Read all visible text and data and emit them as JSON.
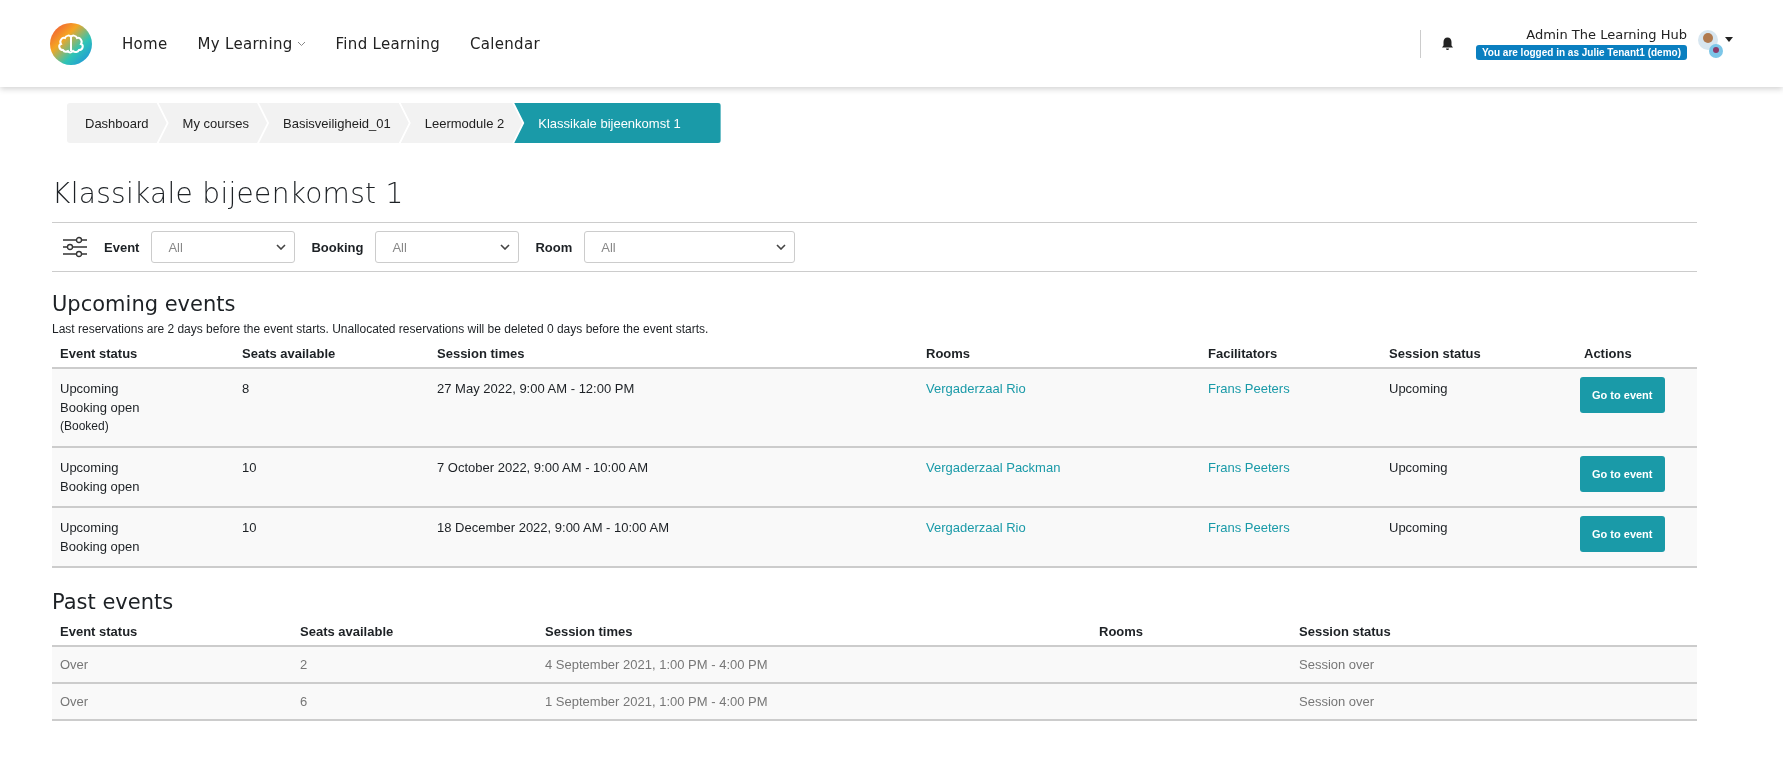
{
  "nav": {
    "items": [
      {
        "label": "Home",
        "has_dropdown": false
      },
      {
        "label": "My Learning",
        "has_dropdown": true
      },
      {
        "label": "Find Learning",
        "has_dropdown": false
      },
      {
        "label": "Calendar",
        "has_dropdown": false
      }
    ]
  },
  "user": {
    "name": "Admin The Learning Hub",
    "login_badge": "You are logged in as Julie Tenant1 (demo)"
  },
  "breadcrumb": [
    {
      "label": "Dashboard",
      "selected": false
    },
    {
      "label": "My courses",
      "selected": false
    },
    {
      "label": "Basisveiligheid_01",
      "selected": false
    },
    {
      "label": "Leermodule 2",
      "selected": false
    },
    {
      "label": "Klassikale bijeenkomst 1",
      "selected": true
    }
  ],
  "page_title": "Klassikale bijeenkomst 1",
  "filters": [
    {
      "label": "Event",
      "value": "All",
      "wide": false
    },
    {
      "label": "Booking",
      "value": "All",
      "wide": false
    },
    {
      "label": "Room",
      "value": "All",
      "wide": true
    }
  ],
  "upcoming": {
    "title": "Upcoming events",
    "note": "Last reservations are 2 days before the event starts. Unallocated reservations will be deleted 0 days before the event starts.",
    "columns": [
      "Event status",
      "Seats available",
      "Session times",
      "Rooms",
      "Facilitators",
      "Session status",
      "Actions"
    ],
    "rows": [
      {
        "event_status": [
          "Upcoming",
          "Booking open"
        ],
        "booked_note": "(Booked)",
        "seats": "8",
        "session_times": "27 May 2022, 9:00 AM - 12:00 PM",
        "room": "Vergaderzaal Rio",
        "facilitator": "Frans Peeters",
        "session_status": "Upcoming",
        "action": "Go to event"
      },
      {
        "event_status": [
          "Upcoming",
          "Booking open"
        ],
        "seats": "10",
        "session_times": "7 October 2022, 9:00 AM - 10:00 AM",
        "room": "Vergaderzaal Packman",
        "facilitator": "Frans Peeters",
        "session_status": "Upcoming",
        "action": "Go to event"
      },
      {
        "event_status": [
          "Upcoming",
          "Booking open"
        ],
        "seats": "10",
        "session_times": "18 December 2022, 9:00 AM - 10:00 AM",
        "room": "Vergaderzaal Rio",
        "facilitator": "Frans Peeters",
        "session_status": "Upcoming",
        "action": "Go to event"
      }
    ]
  },
  "past": {
    "title": "Past events",
    "columns": [
      "Event status",
      "Seats available",
      "Session times",
      "Rooms",
      "Session status"
    ],
    "rows": [
      {
        "event_status": "Over",
        "seats": "2",
        "session_times": "4 September 2021, 1:00 PM - 4:00 PM",
        "session_status": "Session over"
      },
      {
        "event_status": "Over",
        "seats": "6",
        "session_times": "1 September 2021, 1:00 PM - 4:00 PM",
        "session_status": "Session over"
      }
    ]
  }
}
